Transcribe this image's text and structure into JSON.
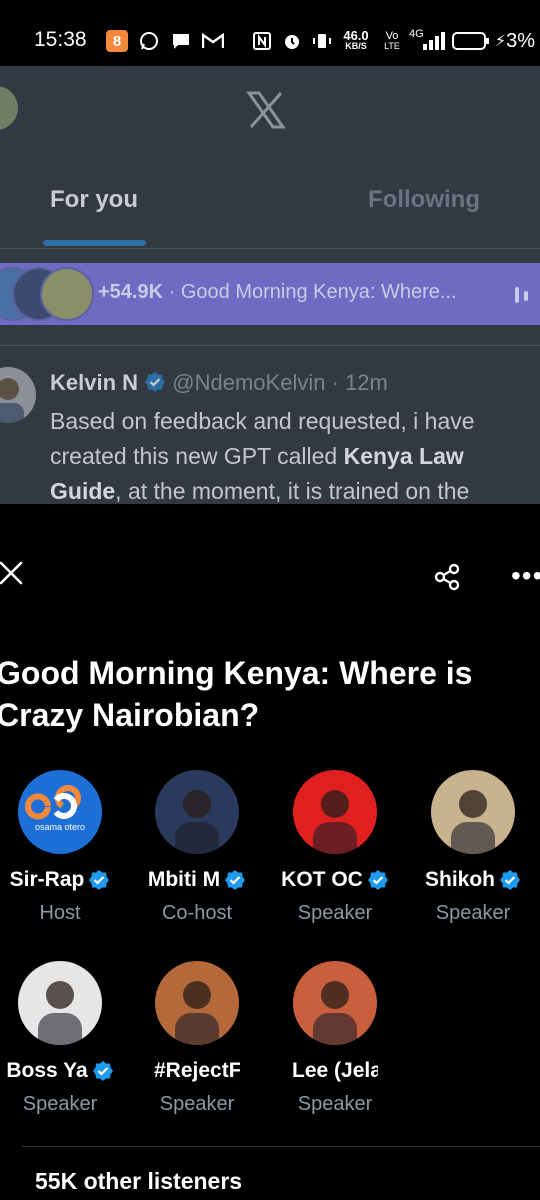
{
  "status_bar": {
    "time": "15:38",
    "net_speed_top": "46.0",
    "net_speed_bottom": "KB/S",
    "volte_top": "Vo",
    "volte_bottom": "LTE",
    "signal_label": "4G",
    "battery": "3%"
  },
  "feed": {
    "tabs": [
      {
        "label": "For you",
        "active": true
      },
      {
        "label": "Following",
        "active": false
      }
    ],
    "space_banner": {
      "count": "+54.9K",
      "separator": " · ",
      "title": "Good Morning Kenya: Where..."
    },
    "tweet": {
      "name": "Kelvin N",
      "handle": "@NdemoKelvin",
      "time": "· 12m",
      "body_line1": "Based on feedback and requested, i have",
      "body_line2": "created this new GPT called ",
      "body_bold1": "Kenya Law",
      "body_bold2": "Guide",
      "body_line3": ", at the moment, it is trained on the"
    }
  },
  "space": {
    "title": "Good Morning Kenya: Where is Crazy Nairobian?",
    "participants": [
      {
        "name": "Sir-Rap",
        "role": "Host",
        "verified": true,
        "color": "#1d6fd6"
      },
      {
        "name": "Mbiti M",
        "role": "Co-host",
        "verified": true,
        "color": "#2a3a5c"
      },
      {
        "name": "KOT OC",
        "role": "Speaker",
        "verified": true,
        "color": "#e0201e"
      },
      {
        "name": "Shikoh",
        "role": "Speaker",
        "verified": true,
        "color": "#c9b38f"
      },
      {
        "name": "Boss Ya",
        "role": "Speaker",
        "verified": true,
        "color": "#e6e6e6"
      },
      {
        "name": "#RejectFi",
        "role": "Speaker",
        "verified": false,
        "color": "#b5683a"
      },
      {
        "name": "Lee (Jelan",
        "role": "Speaker",
        "verified": false,
        "color": "#c95f3c"
      }
    ],
    "listeners": "55K other listeners",
    "host_logo_text": "osama otero"
  },
  "colors": {
    "accent": "#1d9bf0",
    "banner": "#6f6ac2",
    "dim_bg": "#323942"
  }
}
